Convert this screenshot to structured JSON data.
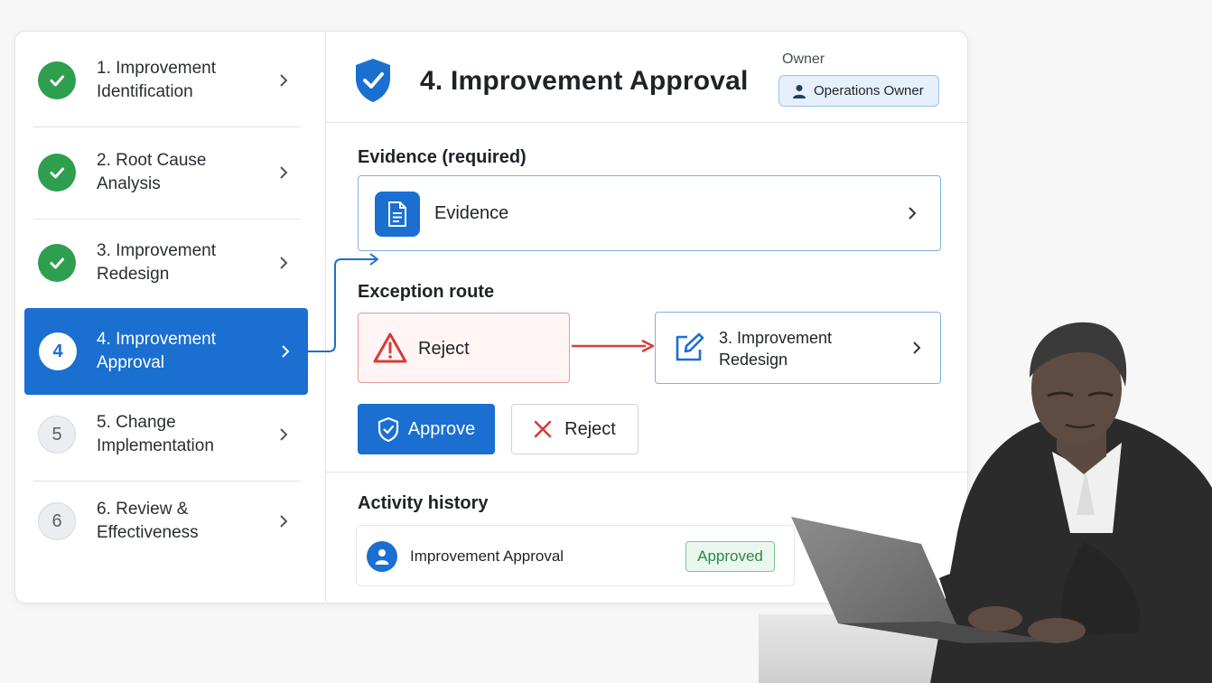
{
  "steps": [
    {
      "number": "1",
      "label": "1. Improvement Identification",
      "status": "done"
    },
    {
      "number": "2",
      "label": "2. Root Cause Analysis",
      "status": "done"
    },
    {
      "number": "3",
      "label": "3. Improvement Redesign",
      "status": "done"
    },
    {
      "number": "4",
      "label": "4. Improvement Approval",
      "status": "current"
    },
    {
      "number": "5",
      "label": "5. Change Implementation",
      "status": "pending"
    },
    {
      "number": "6",
      "label": "6. Review & Effectiveness",
      "status": "pending"
    }
  ],
  "header": {
    "title": "4. Improvement Approval",
    "owner_label": "Owner",
    "owner_value": "Operations Owner"
  },
  "evidence": {
    "section_title": "Evidence (required)",
    "item_label": "Evidence"
  },
  "exception": {
    "section_title": "Exception route",
    "from_label": "Reject",
    "to_label": "3. Improvement Redesign"
  },
  "actions": {
    "approve_label": "Approve",
    "reject_label": "Reject"
  },
  "history": {
    "section_title": "Activity history",
    "entries": [
      {
        "title": "Improvement Approval",
        "status": "Approved"
      }
    ]
  },
  "colors": {
    "accent": "#1a6fd1",
    "done": "#2e9e4f",
    "danger": "#d93a3a",
    "approved_text": "#2b8a47"
  },
  "icons": {
    "header": "shield-check-icon",
    "evidence": "document-icon",
    "exception": "warning-icon",
    "redesign": "edit-icon",
    "avatar": "user-icon"
  }
}
